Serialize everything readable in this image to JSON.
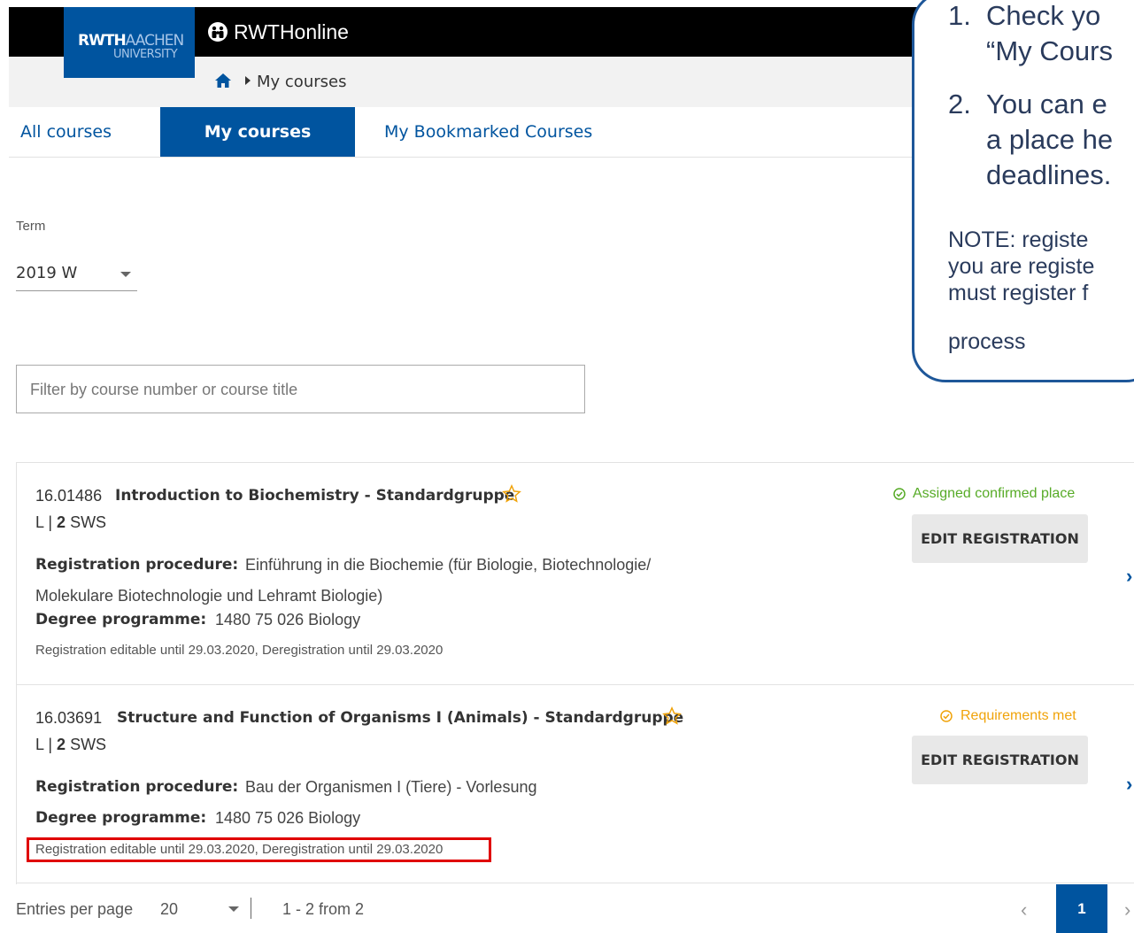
{
  "header": {
    "logo_text_bold": "RWTH",
    "logo_text_light": "AACHEN",
    "logo_text_line2": "UNIVERSITY",
    "app_title": "RWTHonline"
  },
  "breadcrumb": {
    "current": "My courses"
  },
  "tabs": [
    {
      "label": "All courses"
    },
    {
      "label": "My courses",
      "active": true
    },
    {
      "label": "My Bookmarked Courses"
    }
  ],
  "term": {
    "label": "Term",
    "value": "2019 W"
  },
  "filter": {
    "placeholder": "Filter by course number or course title"
  },
  "courses": [
    {
      "number": "16.01486",
      "title": "Introduction to Biochemistry - Standardgruppe",
      "type": "L",
      "sws": "2",
      "sws_unit": "SWS",
      "procedure_label": "Registration procedure:",
      "procedure_line1": "Einführung in die Biochemie (für Biologie, Biotechnologie/",
      "procedure_line2": "Molekulare Biotechnologie und Lehramt Biologie)",
      "degree_label": "Degree programme:",
      "degree_value": "1480 75 026 Biology",
      "deadline": "Registration editable until 29.03.2020, Deregistration until 29.03.2020",
      "status": "Assigned confirmed place",
      "status_color": "#57ab27",
      "button": "EDIT REGISTRATION"
    },
    {
      "number": "16.03691",
      "title": "Structure and Function of Organisms I (Animals) - Standardgruppe",
      "type": "L",
      "sws": "2",
      "sws_unit": "SWS",
      "procedure_label": "Registration procedure:",
      "procedure_line1": "Bau der Organismen I (Tiere) - Vorlesung",
      "degree_label": "Degree programme:",
      "degree_value": "1480 75 026 Biology",
      "deadline": "Registration editable until 29.03.2020, Deregistration until 29.03.2020",
      "status": "Requirements met",
      "status_color": "#f0a30a",
      "button": "EDIT REGISTRATION"
    }
  ],
  "pagination": {
    "entries_label": "Entries per page",
    "entries_value": "20",
    "range": "1 - 2 from 2",
    "current_page": "1"
  },
  "callout": {
    "items": [
      {
        "num": "1.",
        "line1": "Check yo",
        "line2": "“My Cours"
      },
      {
        "num": "2.",
        "line1": "You can e",
        "line2": "a place he",
        "line3": "deadlines."
      }
    ],
    "note_lines": [
      "NOTE: registe",
      "you are registe",
      "must register f",
      "process"
    ]
  },
  "colors": {
    "brand_blue": "#00549f",
    "highlight_red": "#e00000",
    "callout_border": "#1e5799"
  }
}
